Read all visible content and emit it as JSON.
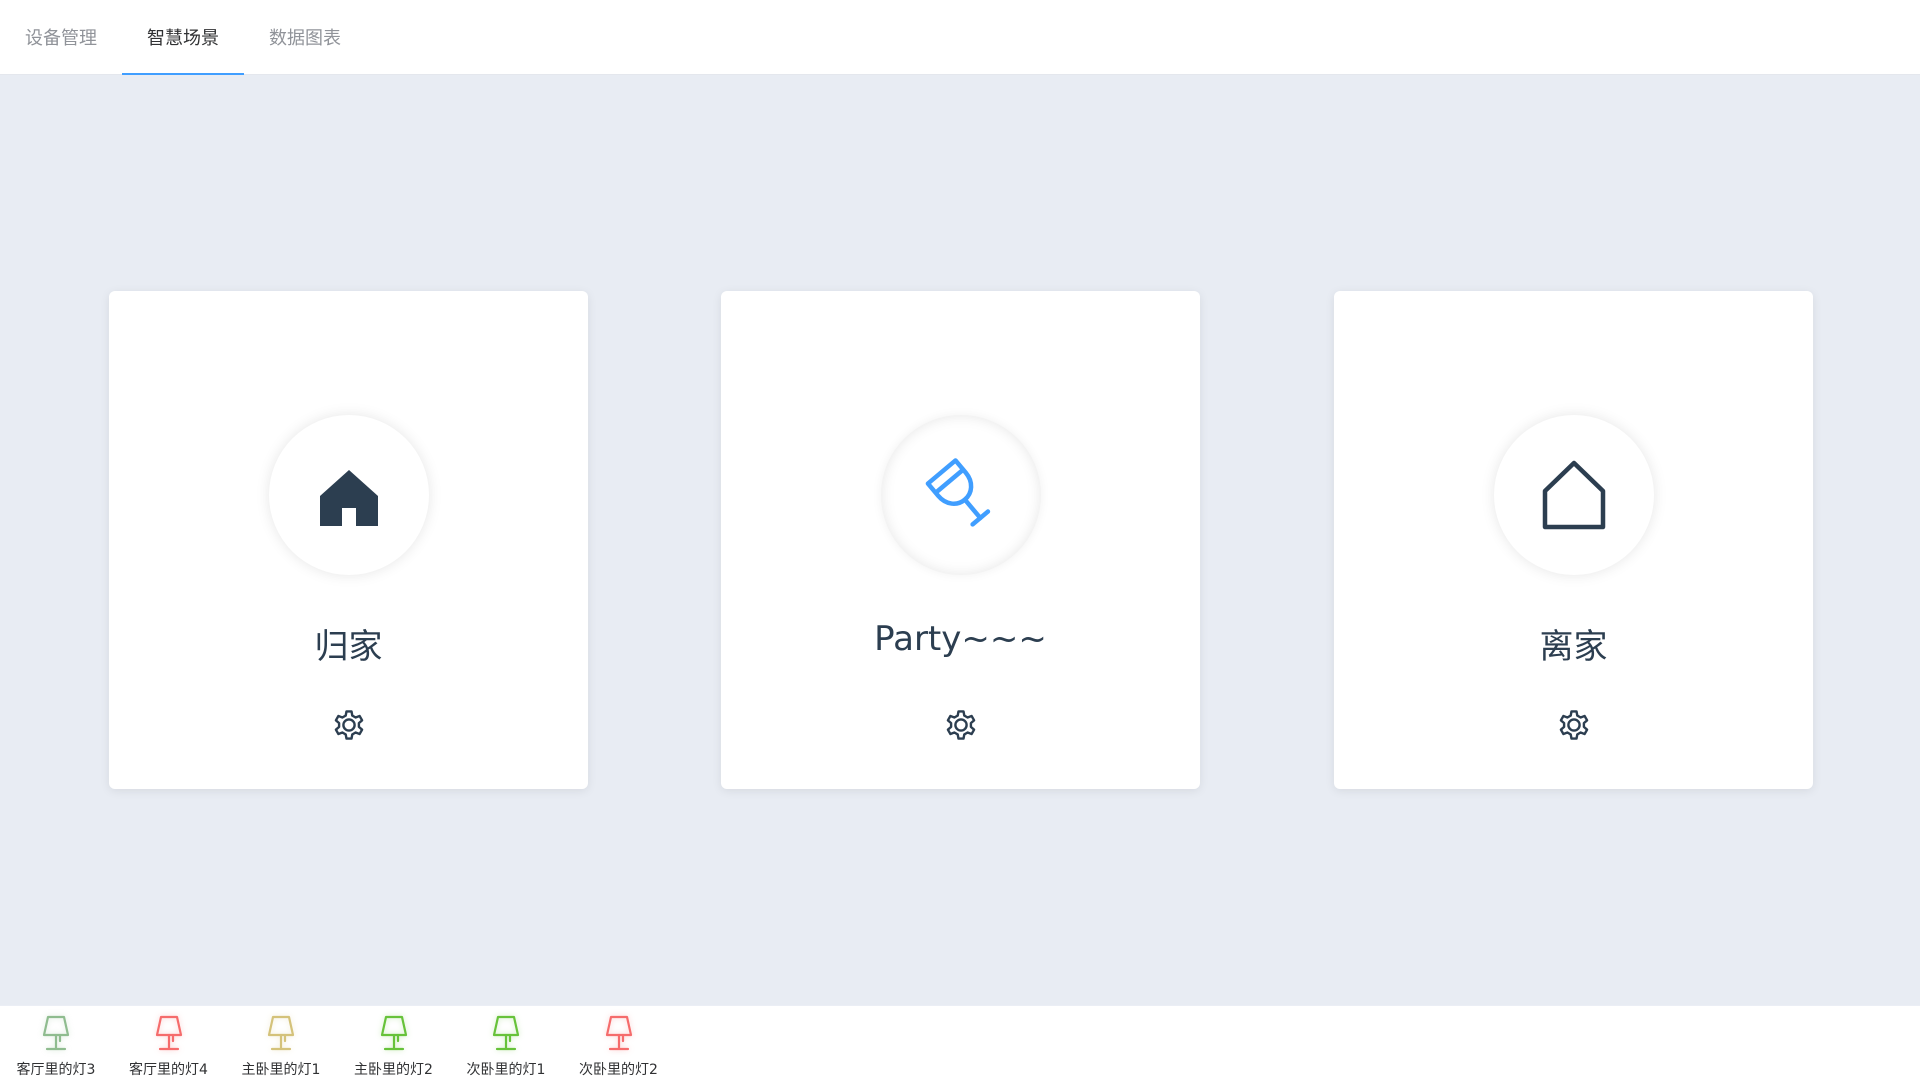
{
  "tabs": [
    {
      "label": "设备管理",
      "active": false
    },
    {
      "label": "智慧场景",
      "active": true
    },
    {
      "label": "数据图表",
      "active": false
    }
  ],
  "scenes": [
    {
      "name": "归家",
      "icon": "home-filled-icon",
      "icon_color": "#2c3e50",
      "active": false
    },
    {
      "name": "Party~~~",
      "icon": "wine-glass-icon",
      "icon_color": "#409eff",
      "active": true
    },
    {
      "name": "离家",
      "icon": "home-outline-icon",
      "icon_color": "#2c3e50",
      "active": false
    }
  ],
  "devices": [
    {
      "label": "客厅里的灯3",
      "icon": "lamp-icon",
      "color": "#8fbc8f"
    },
    {
      "label": "客厅里的灯4",
      "icon": "lamp-icon",
      "color": "#f56c6c"
    },
    {
      "label": "主卧里的灯1",
      "icon": "lamp-icon",
      "color": "#d4c27a"
    },
    {
      "label": "主卧里的灯2",
      "icon": "lamp-icon",
      "color": "#67c23a"
    },
    {
      "label": "次卧里的灯1",
      "icon": "lamp-icon",
      "color": "#67c23a"
    },
    {
      "label": "次卧里的灯2",
      "icon": "lamp-icon",
      "color": "#f56c6c"
    }
  ],
  "colors": {
    "accent": "#409eff",
    "text_dark": "#2c3e50",
    "text_muted": "#909399",
    "background": "#e8ecf3"
  }
}
